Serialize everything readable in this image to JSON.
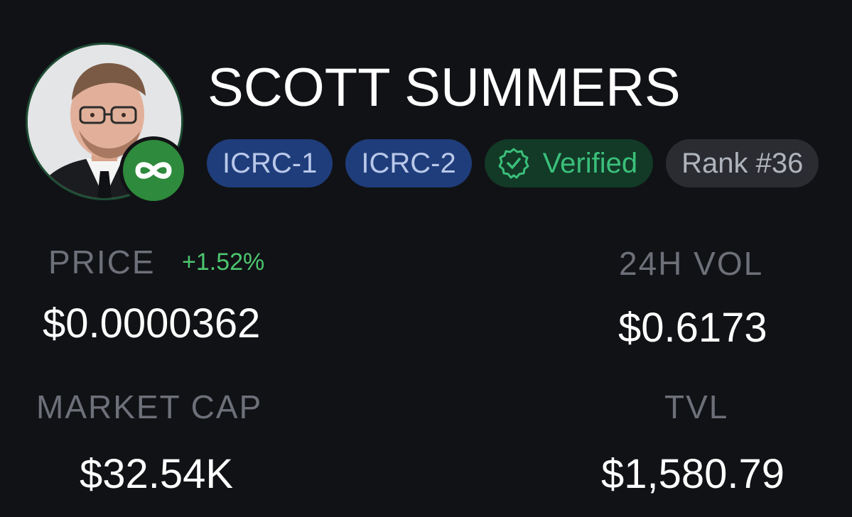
{
  "token": {
    "name": "SCOTT SUMMERS",
    "avatar_icon": "person-photo",
    "chain_badge_icon": "infinity-icon",
    "accent_color": "#2e8a3c"
  },
  "tags": [
    {
      "label": "ICRC-1",
      "color": "#1f3d7a"
    },
    {
      "label": "ICRC-2",
      "color": "#1f3d7a"
    },
    {
      "label": "Verified",
      "icon": "verified-check-icon",
      "color": "#123a27"
    },
    {
      "label": "Rank #36",
      "color": "#2a2c31"
    }
  ],
  "stats": {
    "price": {
      "label": "PRICE",
      "change": "+1.52%",
      "value": "$0.0000362"
    },
    "volume": {
      "label": "24H VOL",
      "value": "$0.6173"
    },
    "market_cap": {
      "label": "MARKET CAP",
      "value": "$32.54K"
    },
    "tvl": {
      "label": "TVL",
      "value": "$1,580.79"
    }
  }
}
